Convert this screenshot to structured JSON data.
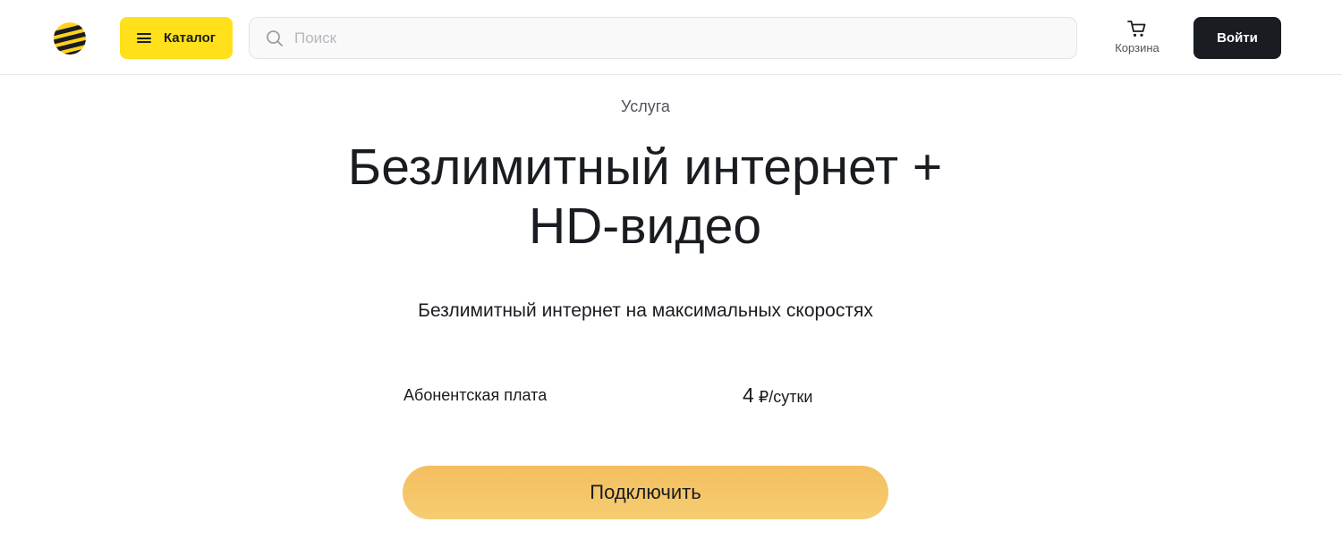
{
  "header": {
    "logo_icon": "beeline-logo-icon",
    "catalog_label": "Каталог",
    "catalog_icon": "burger-menu-icon",
    "search": {
      "placeholder": "Поиск",
      "value": "",
      "icon": "search-icon"
    },
    "cart_label": "Корзина",
    "cart_icon": "cart-icon",
    "login_label": "Войти"
  },
  "service": {
    "eyebrow": "Услуга",
    "title": "Безлимитный интернет + HD-видео",
    "subtitle": "Безлимитный интернет на максимальных скоростях",
    "fee_label": "Абонентская плата",
    "fee_amount": "4",
    "fee_unit": "₽/сутки",
    "connect_label": "Подключить"
  },
  "colors": {
    "accent_yellow": "#ffe01b",
    "connect_button": "#f4c466",
    "dark": "#191c20",
    "text_secondary": "#50545b"
  }
}
